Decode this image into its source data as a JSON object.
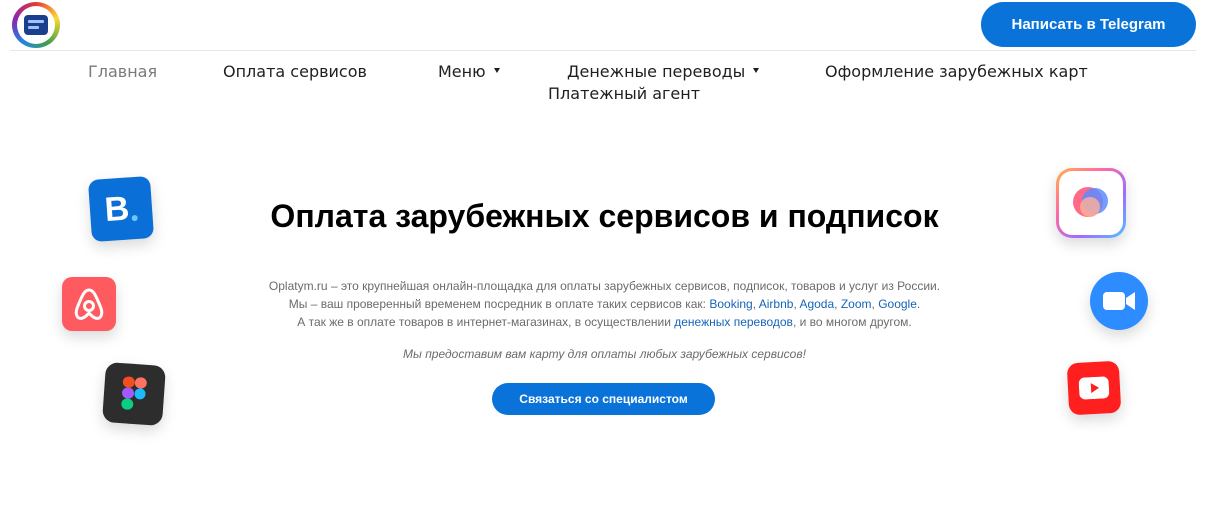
{
  "header": {
    "telegram_button": "Написать в Telegram"
  },
  "nav": {
    "items": [
      {
        "label": "Главная"
      },
      {
        "label": "Оплата сервисов"
      },
      {
        "label": "Меню"
      },
      {
        "label": "Денежные переводы"
      },
      {
        "label": "Оформление зарубежных карт"
      },
      {
        "label": "Платежный агент"
      }
    ]
  },
  "hero": {
    "title": "Оплата зарубежных сервисов и подписок",
    "line1": "Oplatym.ru – это крупнейшая онлайн-площадка для оплаты зарубежных сервисов, подписок, товаров и услуг из России.",
    "line2_prefix": "Мы – ваш проверенный временем посредник в оплате таких сервисов как: ",
    "services": [
      "Booking",
      "Airbnb",
      "Agoda",
      "Zoom",
      "Google"
    ],
    "sep": ", ",
    "line2_end": ".",
    "line3_prefix": "А так же в оплате товаров в интернет-магазинах, в осуществлении ",
    "line3_link": "денежных переводов",
    "line3_suffix": ", и во многом другом.",
    "note": "Мы предоставим вам карту для оплаты любых зарубежных сервисов!",
    "cta": "Связаться со специалистом"
  },
  "icons": {
    "booking": "booking-icon",
    "booking_letter": "B",
    "airbnb": "airbnb-icon",
    "figma": "figma-icon",
    "siri": "siri-icon",
    "zoom": "zoom-icon",
    "youtube": "youtube-icon"
  },
  "colors": {
    "accent": "#0a73d9",
    "link": "#1665b8",
    "airbnb": "#ff5a5f",
    "zoom": "#2d8cff",
    "youtube": "#ff1f1f"
  }
}
